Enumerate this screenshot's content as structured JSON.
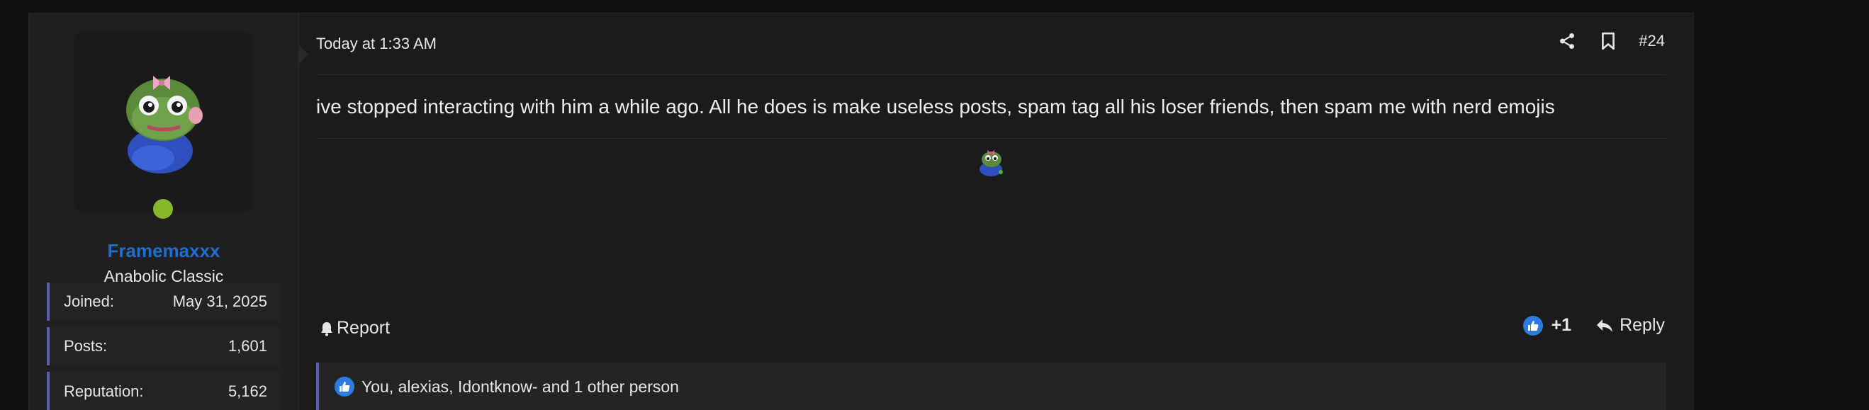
{
  "user": {
    "username": "Framemaxxx",
    "title": "Anabolic Classic",
    "stats": [
      {
        "label": "Joined:",
        "value": "May 31, 2025"
      },
      {
        "label": "Posts:",
        "value": "1,601"
      },
      {
        "label": "Reputation:",
        "value": "5,162"
      }
    ],
    "online_color": "#86b82a",
    "username_color": "#1f6fcf"
  },
  "post": {
    "timestamp": "Today at 1:33 AM",
    "number": "#24",
    "message": "ive stopped interacting with him a while ago. All he does is make useless posts, spam tag all his loser friends, then spam me with nerd emojis",
    "report_label": "Report",
    "reaction_count": "+1",
    "reply_label": "Reply",
    "reactions_summary": "You, alexias, Idontknow- and 1 other person"
  },
  "icons": {
    "share": "share-icon",
    "bookmark": "bookmark-icon",
    "bell": "bell-icon",
    "like": "thumbs-up-icon",
    "reply": "reply-arrow-icon"
  },
  "colors": {
    "accent": "#5b5fb3",
    "like": "#2b7be0"
  }
}
